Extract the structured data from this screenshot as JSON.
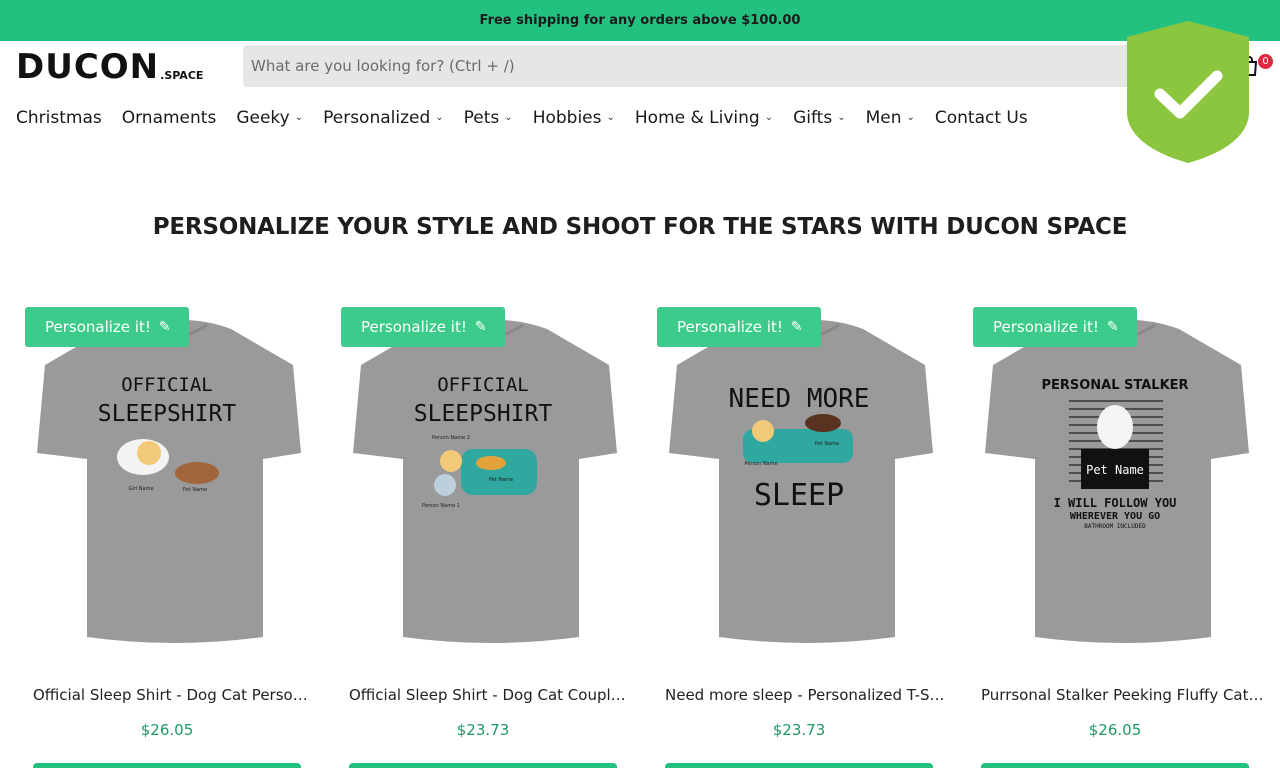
{
  "announcement": "Free shipping for any orders above $100.00",
  "logo": {
    "main": "DUCON",
    "sub": ".SPACE"
  },
  "search": {
    "placeholder": "What are you looking for? (Ctrl + /)",
    "value": ""
  },
  "cart": {
    "count": "0"
  },
  "nav": [
    {
      "label": "Christmas",
      "dropdown": false
    },
    {
      "label": "Ornaments",
      "dropdown": false
    },
    {
      "label": "Geeky",
      "dropdown": true
    },
    {
      "label": "Personalized",
      "dropdown": true
    },
    {
      "label": "Pets",
      "dropdown": true
    },
    {
      "label": "Hobbies",
      "dropdown": true
    },
    {
      "label": "Home & Living",
      "dropdown": true
    },
    {
      "label": "Gifts",
      "dropdown": true
    },
    {
      "label": "Men",
      "dropdown": true
    },
    {
      "label": "Contact Us",
      "dropdown": false
    }
  ],
  "headline": "PERSONALIZE YOUR STYLE AND SHOOT FOR THE STARS WITH DUCON SPACE",
  "products": [
    {
      "badge": "Personalize it!",
      "title": "Official Sleep Shirt - Dog Cat Personalized T-Shirt",
      "price": "$26.05",
      "print": {
        "line1": "OFFICIAL",
        "line2": "SLEEPSHIRT",
        "tag1": "Girl Name",
        "tag2": "Pet Name"
      }
    },
    {
      "badge": "Personalize it!",
      "title": "Official Sleep Shirt - Dog Cat Couple Personalized T-Shirt",
      "price": "$23.73",
      "print": {
        "line1": "OFFICIAL",
        "line2": "SLEEPSHIRT",
        "tag1": "Person Name 2",
        "tag2": "Person Name 1",
        "tag3": "Pet Name"
      }
    },
    {
      "badge": "Personalize it!",
      "title": "Need more sleep - Personalized T-Shirt",
      "price": "$23.73",
      "print": {
        "line1": "NEED MORE",
        "line2": "SLEEP",
        "tag1": "Person Name",
        "tag2": "Pet Name"
      }
    },
    {
      "badge": "Personalize it!",
      "title": "Purrsonal Stalker Peeking Fluffy Cat Personalized T-Shirt",
      "price": "$26.05",
      "print": {
        "line1": "PERSONAL STALKER",
        "line2": "Pet Name",
        "line3": "I WILL FOLLOW YOU",
        "line4": "WHEREVER YOU GO",
        "line5": "BATHROOM INCLUDED"
      }
    }
  ],
  "colors": {
    "brand": "#23c17f",
    "badge": "#3ccb8a",
    "price": "#1d9a63",
    "shield": "#8cc63f",
    "shirt": "#9a9a9a"
  },
  "icons": {
    "cart": "shopping-bag-icon",
    "shield": "shield-check-icon",
    "pencil": "pencil-icon",
    "chevron": "chevron-down-icon"
  }
}
